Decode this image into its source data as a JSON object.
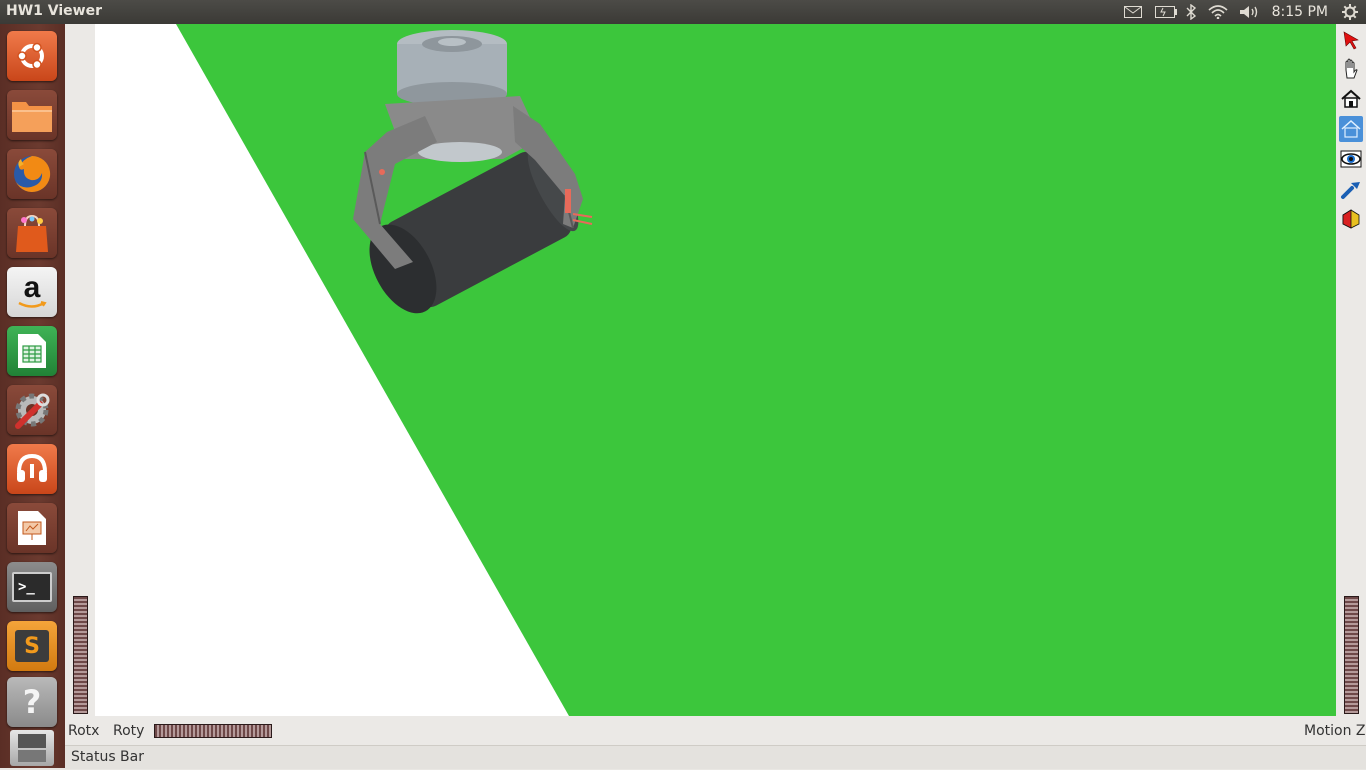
{
  "window": {
    "title": "HW1 Viewer"
  },
  "panel": {
    "clock": "8:15 PM",
    "tray_icons": [
      "mail-icon",
      "battery-icon",
      "bluetooth-icon",
      "wifi-icon",
      "volume-icon",
      "settings-gear-icon"
    ]
  },
  "launcher": {
    "items": [
      {
        "name": "ubuntu-dash",
        "icon": "ubuntu-logo-icon",
        "color": "#e95420"
      },
      {
        "name": "files",
        "icon": "folder-icon",
        "color": "#f08a3c"
      },
      {
        "name": "firefox",
        "icon": "firefox-icon",
        "color": "#e66000"
      },
      {
        "name": "software-center",
        "icon": "shopping-bag-icon",
        "color": "#e2571e"
      },
      {
        "name": "amazon",
        "icon": "amazon-icon",
        "color": "#ffffff"
      },
      {
        "name": "libreoffice-calc",
        "icon": "spreadsheet-icon",
        "color": "#2e9b44"
      },
      {
        "name": "system-settings",
        "icon": "wrench-gear-icon",
        "color": "#888888"
      },
      {
        "name": "ubuntu-one-music",
        "icon": "headphones-icon",
        "color": "#e95420"
      },
      {
        "name": "libreoffice-impress",
        "icon": "presentation-icon",
        "color": "#c2571b"
      },
      {
        "name": "terminal",
        "icon": "terminal-icon",
        "color": "#333333"
      },
      {
        "name": "sublime-text",
        "icon": "sublime-icon",
        "color": "#f29a1c"
      },
      {
        "name": "help",
        "icon": "question-mark-icon",
        "color": "#9a9a9a"
      },
      {
        "name": "workspace-switcher",
        "icon": "workspace-icon",
        "color": "#888888"
      }
    ],
    "terminal_glyph": ">_",
    "sublime_glyph": "S",
    "help_glyph": "?",
    "amazon_glyph": "a"
  },
  "toolbar": {
    "tools": [
      "select-arrow-icon",
      "hand-view-icon",
      "home-view-icon",
      "set-home-icon",
      "view-all-icon",
      "seek-icon",
      "projection-icon"
    ],
    "active_tool": "set-home-icon"
  },
  "viewer": {
    "background_color": "#3cc63c",
    "plane_color": "#ffffff",
    "scene": "robot gripper holding dark cylinder"
  },
  "thumbwheels": {
    "rotx_label": "Rotx",
    "roty_label": "Roty",
    "motionz_label": "Motion Z"
  },
  "status": {
    "text": "Status Bar"
  }
}
